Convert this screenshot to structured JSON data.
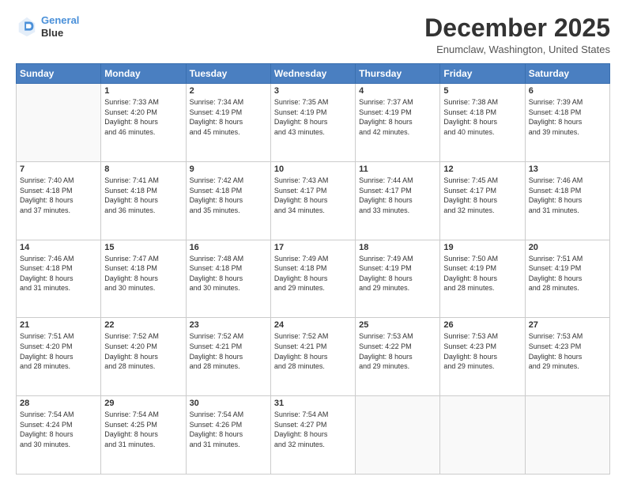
{
  "logo": {
    "line1": "General",
    "line2": "Blue"
  },
  "title": "December 2025",
  "location": "Enumclaw, Washington, United States",
  "days_of_week": [
    "Sunday",
    "Monday",
    "Tuesday",
    "Wednesday",
    "Thursday",
    "Friday",
    "Saturday"
  ],
  "weeks": [
    [
      {
        "day": "",
        "content": ""
      },
      {
        "day": "1",
        "content": "Sunrise: 7:33 AM\nSunset: 4:20 PM\nDaylight: 8 hours\nand 46 minutes."
      },
      {
        "day": "2",
        "content": "Sunrise: 7:34 AM\nSunset: 4:19 PM\nDaylight: 8 hours\nand 45 minutes."
      },
      {
        "day": "3",
        "content": "Sunrise: 7:35 AM\nSunset: 4:19 PM\nDaylight: 8 hours\nand 43 minutes."
      },
      {
        "day": "4",
        "content": "Sunrise: 7:37 AM\nSunset: 4:19 PM\nDaylight: 8 hours\nand 42 minutes."
      },
      {
        "day": "5",
        "content": "Sunrise: 7:38 AM\nSunset: 4:18 PM\nDaylight: 8 hours\nand 40 minutes."
      },
      {
        "day": "6",
        "content": "Sunrise: 7:39 AM\nSunset: 4:18 PM\nDaylight: 8 hours\nand 39 minutes."
      }
    ],
    [
      {
        "day": "7",
        "content": "Sunrise: 7:40 AM\nSunset: 4:18 PM\nDaylight: 8 hours\nand 37 minutes."
      },
      {
        "day": "8",
        "content": "Sunrise: 7:41 AM\nSunset: 4:18 PM\nDaylight: 8 hours\nand 36 minutes."
      },
      {
        "day": "9",
        "content": "Sunrise: 7:42 AM\nSunset: 4:18 PM\nDaylight: 8 hours\nand 35 minutes."
      },
      {
        "day": "10",
        "content": "Sunrise: 7:43 AM\nSunset: 4:17 PM\nDaylight: 8 hours\nand 34 minutes."
      },
      {
        "day": "11",
        "content": "Sunrise: 7:44 AM\nSunset: 4:17 PM\nDaylight: 8 hours\nand 33 minutes."
      },
      {
        "day": "12",
        "content": "Sunrise: 7:45 AM\nSunset: 4:17 PM\nDaylight: 8 hours\nand 32 minutes."
      },
      {
        "day": "13",
        "content": "Sunrise: 7:46 AM\nSunset: 4:18 PM\nDaylight: 8 hours\nand 31 minutes."
      }
    ],
    [
      {
        "day": "14",
        "content": "Sunrise: 7:46 AM\nSunset: 4:18 PM\nDaylight: 8 hours\nand 31 minutes."
      },
      {
        "day": "15",
        "content": "Sunrise: 7:47 AM\nSunset: 4:18 PM\nDaylight: 8 hours\nand 30 minutes."
      },
      {
        "day": "16",
        "content": "Sunrise: 7:48 AM\nSunset: 4:18 PM\nDaylight: 8 hours\nand 30 minutes."
      },
      {
        "day": "17",
        "content": "Sunrise: 7:49 AM\nSunset: 4:18 PM\nDaylight: 8 hours\nand 29 minutes."
      },
      {
        "day": "18",
        "content": "Sunrise: 7:49 AM\nSunset: 4:19 PM\nDaylight: 8 hours\nand 29 minutes."
      },
      {
        "day": "19",
        "content": "Sunrise: 7:50 AM\nSunset: 4:19 PM\nDaylight: 8 hours\nand 28 minutes."
      },
      {
        "day": "20",
        "content": "Sunrise: 7:51 AM\nSunset: 4:19 PM\nDaylight: 8 hours\nand 28 minutes."
      }
    ],
    [
      {
        "day": "21",
        "content": "Sunrise: 7:51 AM\nSunset: 4:20 PM\nDaylight: 8 hours\nand 28 minutes."
      },
      {
        "day": "22",
        "content": "Sunrise: 7:52 AM\nSunset: 4:20 PM\nDaylight: 8 hours\nand 28 minutes."
      },
      {
        "day": "23",
        "content": "Sunrise: 7:52 AM\nSunset: 4:21 PM\nDaylight: 8 hours\nand 28 minutes."
      },
      {
        "day": "24",
        "content": "Sunrise: 7:52 AM\nSunset: 4:21 PM\nDaylight: 8 hours\nand 28 minutes."
      },
      {
        "day": "25",
        "content": "Sunrise: 7:53 AM\nSunset: 4:22 PM\nDaylight: 8 hours\nand 29 minutes."
      },
      {
        "day": "26",
        "content": "Sunrise: 7:53 AM\nSunset: 4:23 PM\nDaylight: 8 hours\nand 29 minutes."
      },
      {
        "day": "27",
        "content": "Sunrise: 7:53 AM\nSunset: 4:23 PM\nDaylight: 8 hours\nand 29 minutes."
      }
    ],
    [
      {
        "day": "28",
        "content": "Sunrise: 7:54 AM\nSunset: 4:24 PM\nDaylight: 8 hours\nand 30 minutes."
      },
      {
        "day": "29",
        "content": "Sunrise: 7:54 AM\nSunset: 4:25 PM\nDaylight: 8 hours\nand 31 minutes."
      },
      {
        "day": "30",
        "content": "Sunrise: 7:54 AM\nSunset: 4:26 PM\nDaylight: 8 hours\nand 31 minutes."
      },
      {
        "day": "31",
        "content": "Sunrise: 7:54 AM\nSunset: 4:27 PM\nDaylight: 8 hours\nand 32 minutes."
      },
      {
        "day": "",
        "content": ""
      },
      {
        "day": "",
        "content": ""
      },
      {
        "day": "",
        "content": ""
      }
    ]
  ]
}
